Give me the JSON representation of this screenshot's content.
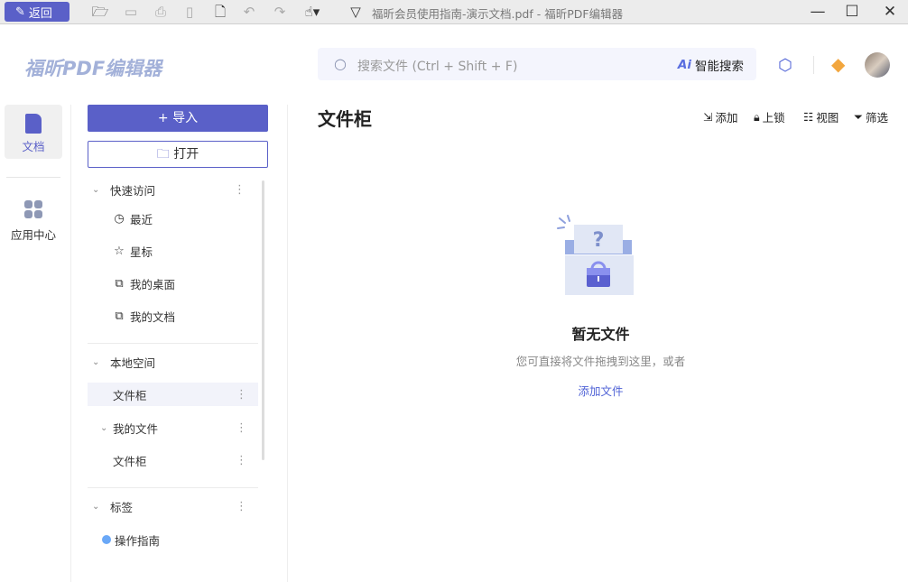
{
  "titlebar": {
    "back_label": "返回",
    "document_title": "福昕会员使用指南-演示文档.pdf - 福昕PDF编辑器"
  },
  "header": {
    "logo": "福昕PDF编辑器",
    "search_placeholder": "搜索文件 (Ctrl + Shift + F)",
    "ai_search_label": "智能搜索"
  },
  "rail": {
    "items": [
      {
        "label": "文档"
      },
      {
        "label": "应用中心"
      }
    ]
  },
  "panel": {
    "import_label": "+ 导入",
    "open_label": "打开",
    "quick_access": {
      "title": "快速访问",
      "items": [
        {
          "label": "最近"
        },
        {
          "label": "星标"
        },
        {
          "label": "我的桌面"
        },
        {
          "label": "我的文档"
        }
      ]
    },
    "local_space": {
      "title": "本地空间",
      "items": [
        {
          "label": "文件柜"
        },
        {
          "label": "我的文件"
        },
        {
          "label": "文件柜"
        }
      ]
    },
    "tags": {
      "title": "标签",
      "items": [
        {
          "label": "操作指南",
          "color": "#6aa8f7"
        }
      ]
    }
  },
  "main": {
    "title": "文件柜",
    "actions": [
      {
        "label": "添加"
      },
      {
        "label": "上锁"
      },
      {
        "label": "视图"
      },
      {
        "label": "筛选"
      }
    ],
    "empty_title": "暂无文件",
    "empty_subtitle": "您可直接将文件拖拽到这里，或者",
    "empty_link": "添加文件"
  },
  "colors": {
    "accent": "#5a60c8",
    "link": "#4f62d6"
  }
}
